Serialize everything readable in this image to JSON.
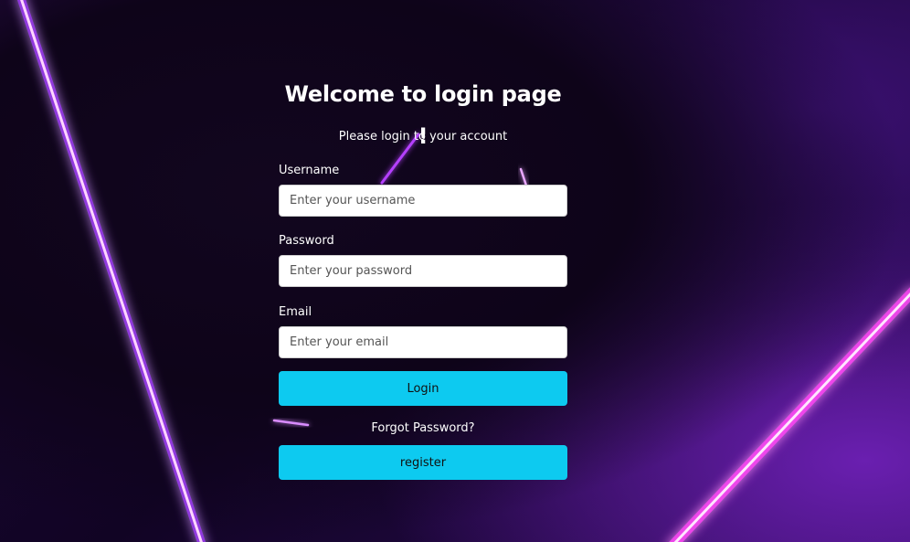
{
  "login": {
    "title": "Welcome to login page !",
    "subtitle": "Please login to your account",
    "fields": {
      "username": {
        "label": "Username",
        "placeholder": "Enter your username",
        "value": ""
      },
      "password": {
        "label": "Password",
        "placeholder": "Enter your password",
        "value": ""
      },
      "email": {
        "label": "Email",
        "placeholder": "Enter your email",
        "value": ""
      }
    },
    "login_label": "Login",
    "forgot_label": "Forgot Password?",
    "register_label": "register"
  },
  "colors": {
    "button": "#0dcaf0",
    "neon_line": "#ff7bff",
    "neon_glow": "#a02bff",
    "background": "#110424"
  }
}
